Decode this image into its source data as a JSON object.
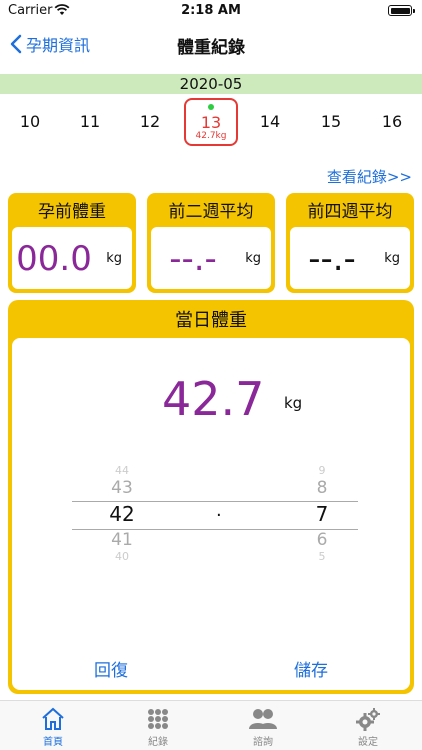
{
  "status": {
    "carrier": "Carrier",
    "time": "2:18 AM"
  },
  "nav": {
    "back_label": "孕期資訊",
    "title": "體重紀錄"
  },
  "calendar": {
    "month": "2020-05",
    "days": [
      "10",
      "11",
      "12",
      "13",
      "14",
      "15",
      "16"
    ],
    "selected_day": "13",
    "selected_weight": "42.7kg"
  },
  "view_records_link": "查看紀錄>>",
  "cards": [
    {
      "label": "孕前體重",
      "value": "00.0",
      "unit": "kg"
    },
    {
      "label": "前二週平均",
      "value": "--.-",
      "unit": "kg"
    },
    {
      "label": "前四週平均",
      "value": "--.-",
      "unit": "kg"
    }
  ],
  "daily": {
    "title": "當日體重",
    "value": "42.7",
    "unit": "kg",
    "picker_int": [
      "44",
      "43",
      "42",
      "41",
      "40"
    ],
    "picker_sep": ".",
    "picker_dec": [
      "9",
      "8",
      "7",
      "6",
      "5"
    ],
    "restore_label": "回復",
    "save_label": "儲存"
  },
  "tabs": [
    {
      "label": "首頁",
      "icon": "home-icon"
    },
    {
      "label": "紀錄",
      "icon": "grid-icon"
    },
    {
      "label": "諮詢",
      "icon": "people-icon"
    },
    {
      "label": "設定",
      "icon": "gears-icon"
    }
  ],
  "colors": {
    "accent": "#1e6fdc",
    "card_yellow": "#f5c400",
    "value_purple": "#8a2899",
    "selected_red": "#e53935",
    "month_green": "#cdeabc"
  }
}
